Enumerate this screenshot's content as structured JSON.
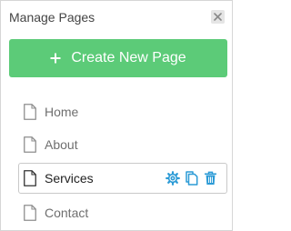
{
  "panel": {
    "title": "Manage Pages",
    "close_icon": "close-icon"
  },
  "create_button": {
    "label": "Create New Page",
    "icon": "plus-icon",
    "color": "#5ccb78"
  },
  "pages": [
    {
      "label": "Home",
      "icon": "document-icon",
      "selected": false
    },
    {
      "label": "About",
      "icon": "document-icon",
      "selected": false
    },
    {
      "label": "Services",
      "icon": "document-icon",
      "selected": true
    },
    {
      "label": "Contact",
      "icon": "document-icon",
      "selected": false
    }
  ],
  "row_actions": {
    "icons": [
      "gear-icon",
      "copy-icon",
      "trash-icon"
    ],
    "color": "#2c9bd6"
  }
}
